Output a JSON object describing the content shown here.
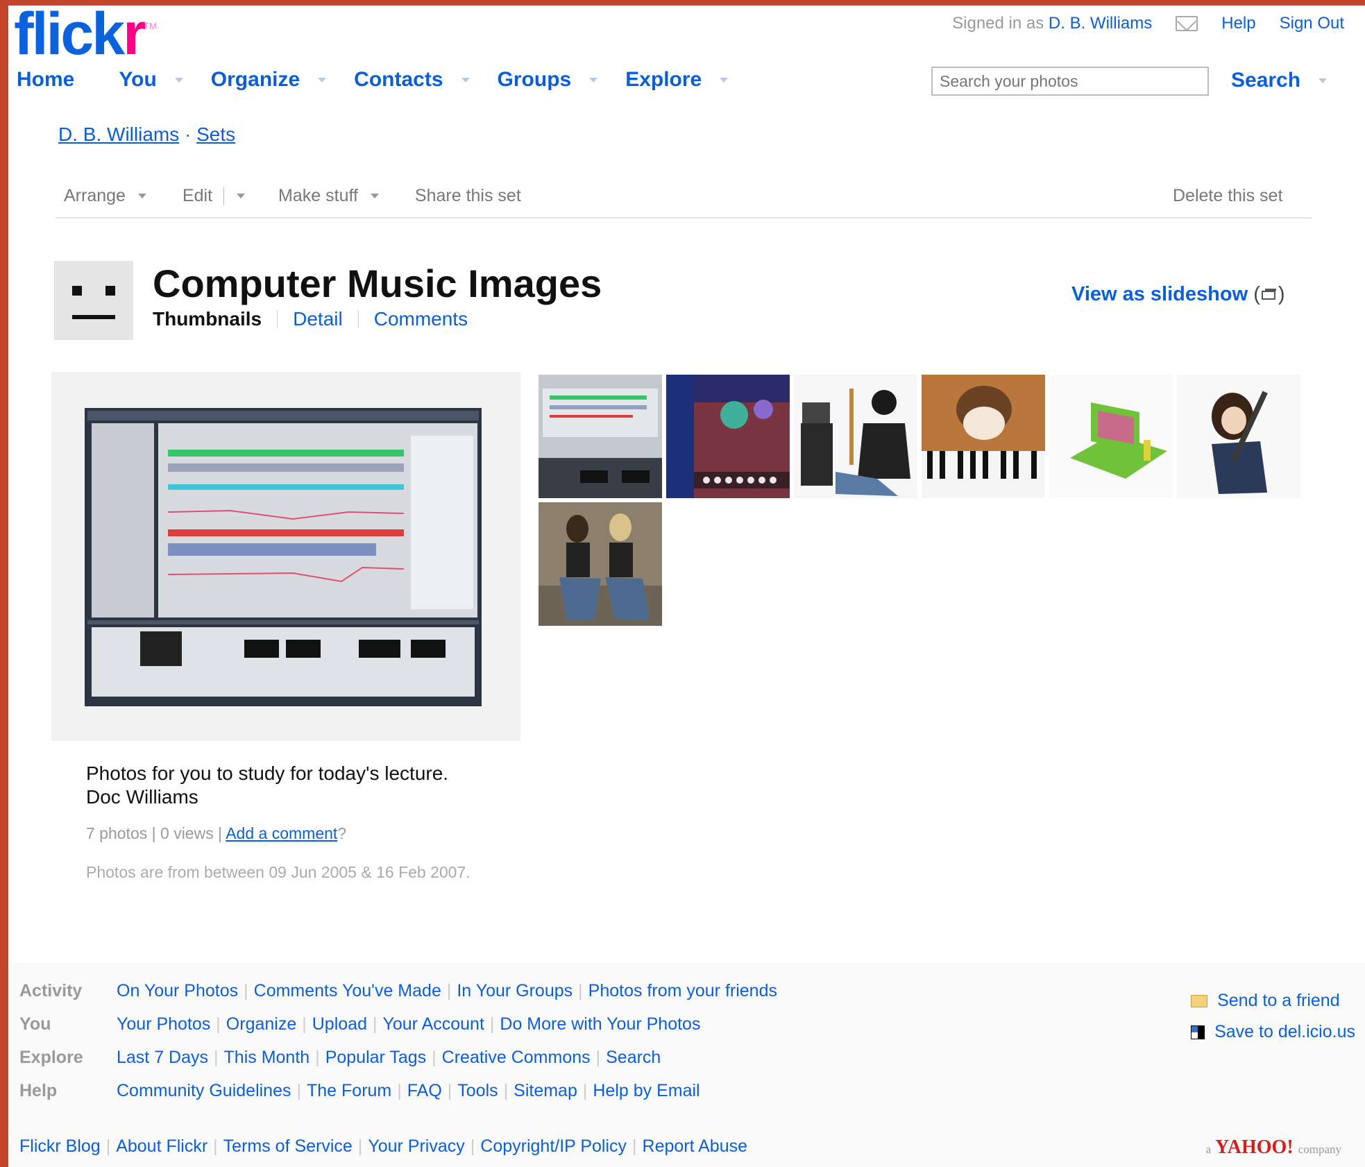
{
  "logo": {
    "text": "flick",
    "r": "r",
    "tm": "TM"
  },
  "topbar": {
    "signed_in": "Signed in as",
    "user": "D. B. Williams",
    "help": "Help",
    "sign_out": "Sign Out"
  },
  "nav": {
    "home": "Home",
    "you": "You",
    "organize": "Organize",
    "contacts": "Contacts",
    "groups": "Groups",
    "explore": "Explore"
  },
  "search": {
    "placeholder": "Search your photos",
    "button": "Search"
  },
  "breadcrumb": {
    "user": "D. B. Williams",
    "sep": "·",
    "sets": "Sets"
  },
  "toolbar": {
    "arrange": "Arrange",
    "edit": "Edit",
    "make_stuff": "Make stuff",
    "share": "Share this set",
    "delete": "Delete this set"
  },
  "set": {
    "title": "Computer Music Images",
    "tab_thumbnails": "Thumbnails",
    "tab_detail": "Detail",
    "tab_comments": "Comments",
    "slideshow": "View as slideshow",
    "description_line1": "Photos for you to study for today's lecture.",
    "description_line2": "Doc Williams",
    "photo_count": "7 photos",
    "views": "0 views",
    "add_comment": "Add a comment",
    "date_range": "Photos are from between 09 Jun 2005 & 16 Feb 2007."
  },
  "thumbnails": [
    "daw-screenshot",
    "synth-plugin",
    "guitarist-laptop",
    "piano-keys",
    "green-laptop",
    "girl-guitar",
    "two-people-sitting"
  ],
  "footer": {
    "activity_label": "Activity",
    "activity_links": [
      "On Your Photos",
      "Comments You've Made",
      "In Your Groups",
      "Photos from your friends"
    ],
    "you_label": "You",
    "you_links": [
      "Your Photos",
      "Organize",
      "Upload",
      "Your Account",
      "Do More with Your Photos"
    ],
    "explore_label": "Explore",
    "explore_links": [
      "Last 7 Days",
      "This Month",
      "Popular Tags",
      "Creative Commons",
      "Search"
    ],
    "help_label": "Help",
    "help_links": [
      "Community Guidelines",
      "The Forum",
      "FAQ",
      "Tools",
      "Sitemap",
      "Help by Email"
    ],
    "send_friend": "Send to a friend",
    "save_delicious": "Save to del.icio.us",
    "bottom_links": [
      "Flickr Blog",
      "About Flickr",
      "Terms of Service",
      "Your Privacy",
      "Copyright/IP Policy",
      "Report Abuse"
    ],
    "yahoo_a": "a",
    "yahoo": "YAHOO!",
    "yahoo_company": "company"
  },
  "colors": {
    "link": "#0a5fd8",
    "flickr_blue": "#0a63dc",
    "flickr_pink": "#ff0084",
    "frame": "#c4452c"
  }
}
